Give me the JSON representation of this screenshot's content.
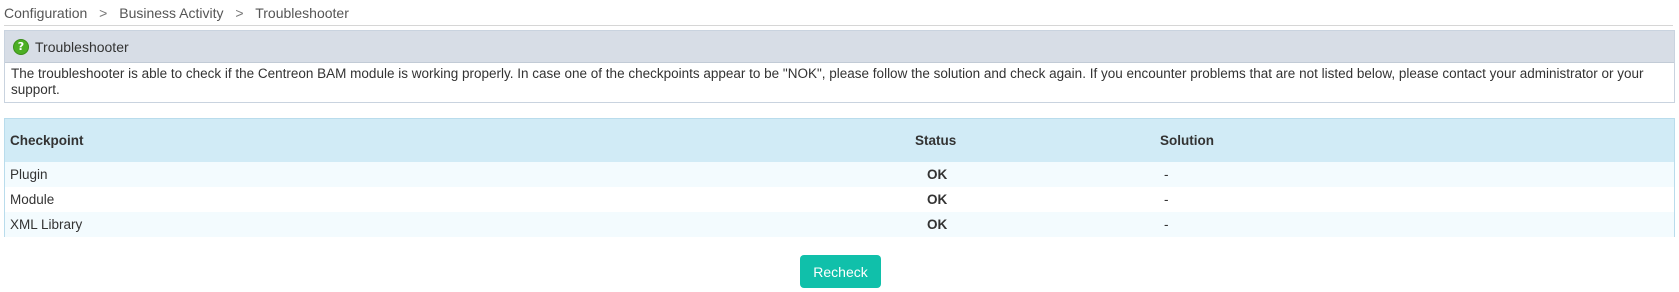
{
  "breadcrumb": {
    "items": [
      "Configuration",
      "Business Activity",
      "Troubleshooter"
    ],
    "separator": ">"
  },
  "help": {
    "title": "Troubleshooter",
    "icon": "help-icon",
    "text": "The troubleshooter is able to check if the Centreon BAM module is working properly. In case one of the checkpoints appear to be \"NOK\", please follow the solution and check again. If you encounter problems that are not listed below, please contact your administrator or your support."
  },
  "table": {
    "headers": [
      "Checkpoint",
      "Status",
      "Solution"
    ],
    "rows": [
      {
        "checkpoint": "Plugin",
        "status": "OK",
        "solution": "-"
      },
      {
        "checkpoint": "Module",
        "status": "OK",
        "solution": "-"
      },
      {
        "checkpoint": "XML Library",
        "status": "OK",
        "solution": "-"
      }
    ]
  },
  "recheck_label": "Recheck",
  "colors": {
    "ok": "#59b84a",
    "button": "#10c0aa",
    "header_bg": "#d1ebf6"
  }
}
